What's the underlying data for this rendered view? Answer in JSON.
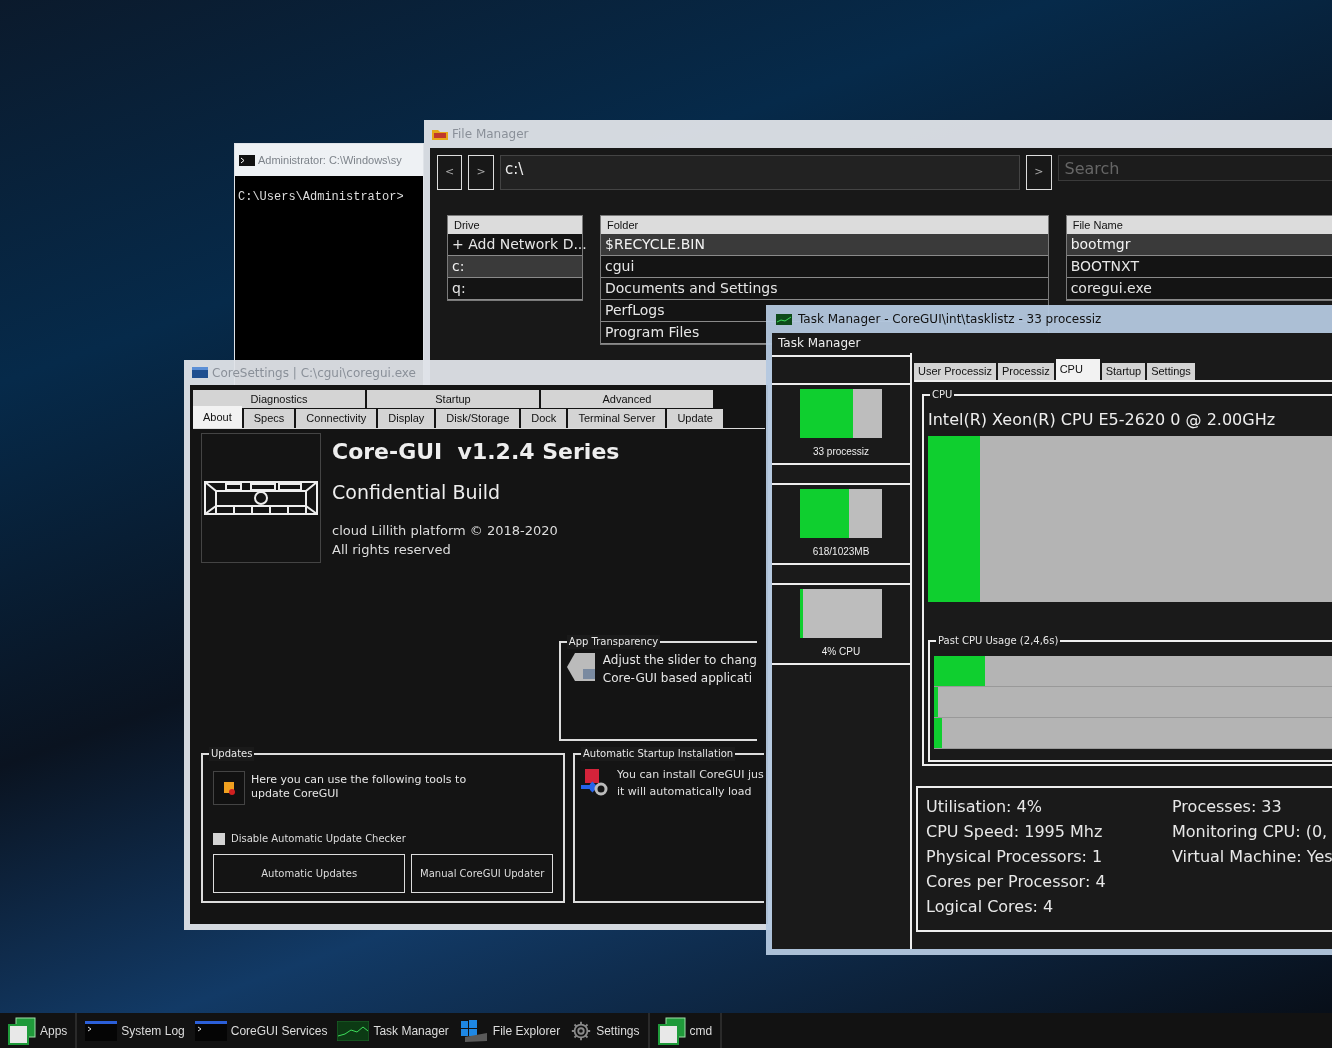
{
  "cmd_window": {
    "title": "Administrator: C:\\Windows\\sy",
    "prompt": "C:\\Users\\Administrator>"
  },
  "file_manager": {
    "title": "File Manager",
    "back": "<",
    "forward": ">",
    "path": "c:\\",
    "go": ">",
    "search": {
      "placeholder": "Search"
    },
    "drives": {
      "column": "Drive",
      "rows": [
        {
          "label": "+ Add Network D...",
          "selected": false
        },
        {
          "label": "c:",
          "selected": true
        },
        {
          "label": "q:",
          "selected": false
        }
      ]
    },
    "folders": {
      "column": "Folder",
      "rows": [
        {
          "label": "$RECYCLE.BIN",
          "selected": true
        },
        {
          "label": "cgui",
          "selected": false
        },
        {
          "label": "Documents and Settings",
          "selected": false
        },
        {
          "label": "PerfLogs",
          "selected": false
        },
        {
          "label": "Program Files",
          "selected": false
        }
      ]
    },
    "files": {
      "column": "File Name",
      "rows": [
        {
          "label": "bootmgr",
          "selected": true
        },
        {
          "label": "BOOTNXT",
          "selected": false
        },
        {
          "label": "coregui.exe",
          "selected": false
        }
      ]
    }
  },
  "core_settings": {
    "title": "CoreSettings | C:\\cgui\\coregui.exe",
    "tab_row_top": [
      {
        "label": "Diagnostics",
        "selected": false
      },
      {
        "label": "Startup",
        "selected": false
      },
      {
        "label": "Advanced",
        "selected": false
      }
    ],
    "tab_row_bottom": [
      {
        "label": "About",
        "selected": true
      },
      {
        "label": "Specs",
        "selected": false
      },
      {
        "label": "Connectivity",
        "selected": false
      },
      {
        "label": "Display",
        "selected": false
      },
      {
        "label": "Disk/Storage",
        "selected": false
      },
      {
        "label": "Dock",
        "selected": false
      },
      {
        "label": "Terminal Server",
        "selected": false
      },
      {
        "label": "Update",
        "selected": false
      }
    ],
    "about": {
      "heading": "Core-GUI  v1.2.4 Series",
      "subheading": "Confidential Build",
      "copyright": "cloud Lillith platform © 2018-2020",
      "rights": "All rights reserved"
    },
    "transparency": {
      "legend": "App Transparency",
      "lines": [
        "Adjust the slider to chang",
        "Core-GUI based applicati"
      ]
    },
    "updates": {
      "legend": "Updates",
      "text": "Here you can use the following tools to update CoreGUI",
      "checkbox": {
        "label": "Disable Automatic Update Checker",
        "checked": false
      },
      "buttons": [
        "Automatic Updates",
        "Manual CoreGUI Updater"
      ]
    },
    "startup_install": {
      "legend": "Automatic Startup Installation",
      "lines": [
        "You can install CoreGUI jus",
        "it will automatically load"
      ]
    }
  },
  "task_manager": {
    "title": "Task Manager - CoreGUI\\int\\tasklistz - 33 processiz",
    "menu": "Task Manager",
    "tiles": [
      {
        "label": "33 processiz",
        "level": 0.65
      },
      {
        "label": "618/1023MB",
        "level": 0.6
      },
      {
        "label": "4% CPU",
        "level": 0.04
      }
    ],
    "tabs": [
      {
        "label": "User Processiz",
        "selected": false
      },
      {
        "label": "Processiz",
        "selected": false
      },
      {
        "label": "CPU",
        "selected": true
      },
      {
        "label": "Startup",
        "selected": false
      },
      {
        "label": "Settings",
        "selected": false
      }
    ],
    "cpu": {
      "legend": "CPU",
      "model": "Intel(R) Xeon(R) CPU E5-2620 0 @ 2.00GHz",
      "level": 0.12
    },
    "past": {
      "legend": "Past CPU Usage (2,4,6s)",
      "bars": [
        {
          "level": 0.12
        },
        {
          "level": 0.01
        },
        {
          "level": 0.02
        }
      ]
    },
    "stats_left": [
      "Utilisation: 4%",
      "CPU Speed: 1995 Mhz",
      "Physical Processors: 1",
      "Cores per Processor: 4",
      "Logical Cores: 4"
    ],
    "stats_right": [
      "Processes: 33",
      "Monitoring CPU: (0,",
      "Virtual Machine: Yes"
    ]
  },
  "taskbar": {
    "groups": [
      [
        {
          "label": "Apps",
          "kind": "apps"
        }
      ],
      [
        {
          "label": "System Log",
          "kind": "terminal"
        },
        {
          "label": "CoreGUI Services",
          "kind": "terminal"
        },
        {
          "label": "Task Manager",
          "kind": "monitor"
        },
        {
          "label": "File Explorer",
          "kind": "explorer"
        },
        {
          "label": "Settings",
          "kind": "gear"
        }
      ],
      [
        {
          "label": "cmd",
          "kind": "apps"
        }
      ]
    ]
  }
}
